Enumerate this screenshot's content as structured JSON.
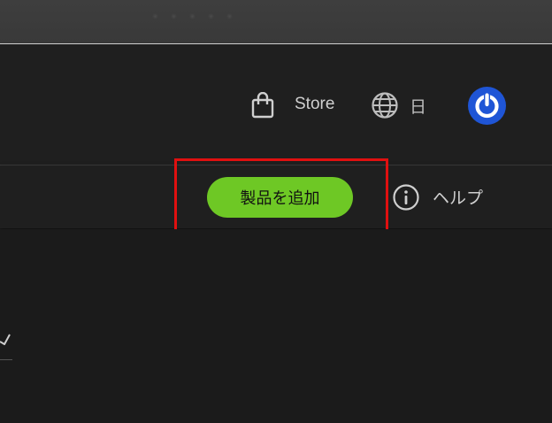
{
  "top_bar": {
    "blurred_text": "・・・・・"
  },
  "header": {
    "store_label": "Store",
    "language_label": "日",
    "icons": {
      "store": "shopping-bag-icon",
      "language": "globe-icon",
      "account": "power-account-icon"
    },
    "colors": {
      "account_blue": "#1f55d6"
    }
  },
  "toolbar": {
    "add_product_label": "製品を追加",
    "help_label": "ヘルプ",
    "icons": {
      "help": "info-circle-icon"
    },
    "colors": {
      "accent_green": "#6ec825",
      "highlight_red": "#e01010"
    }
  }
}
